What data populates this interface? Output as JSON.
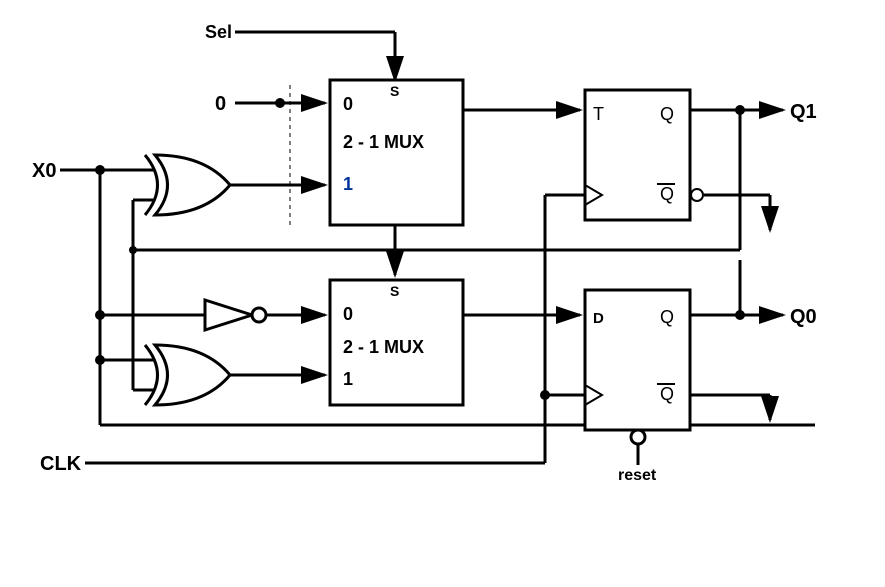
{
  "labels": {
    "sel": "Sel",
    "zero": "0",
    "x0": "X0",
    "clk": "CLK",
    "reset": "reset",
    "q1": "Q1",
    "q0": "Q0"
  },
  "mux": {
    "sel_label": "S",
    "in0": "0",
    "in1": "1",
    "title": "2 - 1 MUX"
  },
  "ff": {
    "t": "T",
    "d": "D",
    "q": "Q",
    "qbar": "Q"
  },
  "components": [
    {
      "type": "xor",
      "name": "xor-top"
    },
    {
      "type": "xor",
      "name": "xor-bottom"
    },
    {
      "type": "not",
      "name": "inverter"
    },
    {
      "type": "mux",
      "name": "mux-top"
    },
    {
      "type": "mux",
      "name": "mux-bottom"
    },
    {
      "type": "t-flipflop",
      "name": "ff-top"
    },
    {
      "type": "d-flipflop",
      "name": "ff-bottom"
    }
  ],
  "signals": [
    "Sel",
    "X0",
    "CLK",
    "reset",
    "Q1",
    "Q0"
  ]
}
